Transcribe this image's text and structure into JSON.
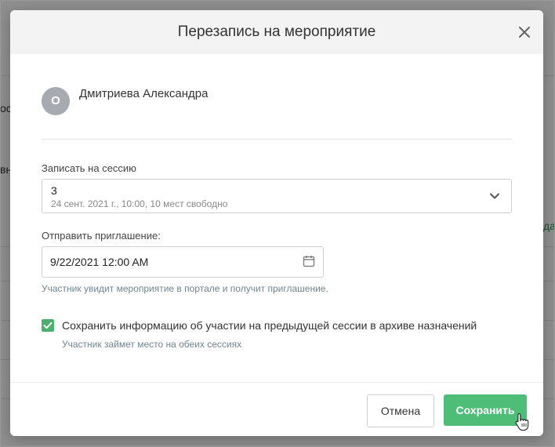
{
  "background": {
    "fragments": [
      "ос",
      "вн",
      "дат"
    ]
  },
  "modal": {
    "title": "Перезапись на мероприятие",
    "close_icon": "close-icon"
  },
  "participant": {
    "avatar_initial": "О",
    "name": "Дмитриева Александра"
  },
  "session": {
    "label": "Записать на сессию",
    "selected_value": "3",
    "selected_details": "24 сент. 2021 г., 10:00, 10 мест свободно",
    "icon": "chevron-down-icon"
  },
  "invitation": {
    "label": "Отправить приглашение:",
    "date_value": "9/22/2021 12:00 AM",
    "icon": "calendar-icon",
    "hint": "Участник увидит мероприятие в портале и получит приглашение."
  },
  "archive": {
    "checked": true,
    "label": "Сохранить информацию об участии на предыдущей сессии в архиве назначений",
    "hint": "Участник займет место на обеих сессиях"
  },
  "footer": {
    "cancel_label": "Отмена",
    "save_label": "Сохранить"
  },
  "colors": {
    "primary": "#4dbd78",
    "checkbox": "#4caf6e",
    "hint": "#6f8593",
    "avatar": "#a7aab0"
  }
}
